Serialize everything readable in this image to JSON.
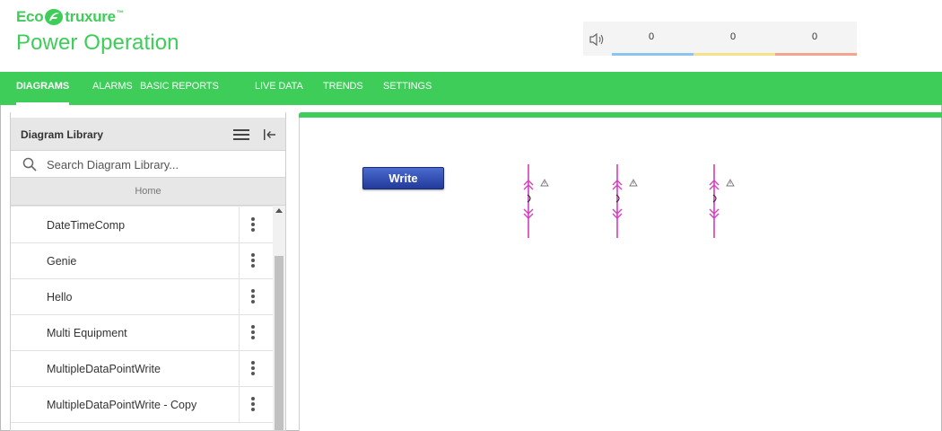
{
  "brand": {
    "line1_left": "Eco",
    "line1_right": "truxure",
    "trademark": "™",
    "product": "Power Operation",
    "color": "#3dcd58"
  },
  "alarms": {
    "icon": "speaker-icon",
    "counts": [
      "0",
      "0",
      "0"
    ],
    "bar_colors": [
      "#8cc4f0",
      "#f6e08a",
      "#f2a58c"
    ]
  },
  "nav": {
    "items": [
      {
        "label": "DIAGRAMS",
        "active": true
      },
      {
        "label": "ALARMS",
        "active": false
      },
      {
        "label": "BASIC REPORTS",
        "active": false
      },
      {
        "label": "LIVE DATA",
        "active": false
      },
      {
        "label": "TRENDS",
        "active": false
      },
      {
        "label": "SETTINGS",
        "active": false
      }
    ]
  },
  "sidebar": {
    "title": "Diagram Library",
    "menu_icon": "hamburger-menu-icon",
    "collapse_icon": "collapse-left-icon",
    "search_placeholder": "Search Diagram Library...",
    "breadcrumb": "Home",
    "items": [
      {
        "label": "DateTimeComp"
      },
      {
        "label": "Genie"
      },
      {
        "label": "Hello"
      },
      {
        "label": "Multi Equipment"
      },
      {
        "label": "MultipleDataPointWrite"
      },
      {
        "label": "MultipleDataPointWrite - Copy"
      }
    ]
  },
  "canvas": {
    "write_button": "Write",
    "breaker_count": 3,
    "breaker_icon": "circuit-breaker-icon",
    "warning_icon": "warning-triangle-icon",
    "breaker_color": "#d63cc0"
  }
}
